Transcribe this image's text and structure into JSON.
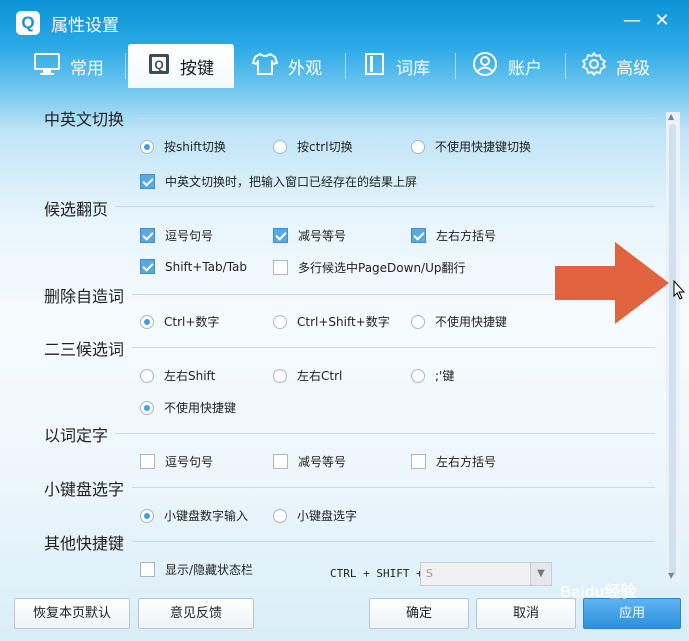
{
  "window": {
    "title": "属性设置",
    "logo": "Q"
  },
  "tabs": [
    {
      "label": "常用",
      "icon": "monitor-icon"
    },
    {
      "label": "按键",
      "icon": "keyboard-q-icon",
      "active": true
    },
    {
      "label": "外观",
      "icon": "tshirt-icon"
    },
    {
      "label": "词库",
      "icon": "book-icon"
    },
    {
      "label": "账户",
      "icon": "user-icon"
    },
    {
      "label": "高级",
      "icon": "gear-icon"
    }
  ],
  "sections": {
    "switch": {
      "title": "中英文切换",
      "radios": [
        "按shift切换",
        "按ctrl切换",
        "不使用快捷键切换"
      ],
      "selected": 0,
      "checkbox": {
        "label": "中英文切换时，把输入窗口已经存在的结果上屏",
        "checked": true
      }
    },
    "paging": {
      "title": "候选翻页",
      "checks": [
        {
          "label": "逗号句号",
          "checked": true
        },
        {
          "label": "减号等号",
          "checked": true
        },
        {
          "label": "左右方括号",
          "checked": true
        },
        {
          "label": "Shift+Tab/Tab",
          "checked": true
        },
        {
          "label": "多行候选中PageDown/Up翻行",
          "checked": false
        }
      ]
    },
    "delete_word": {
      "title": "删除自造词",
      "radios": [
        "Ctrl+数字",
        "Ctrl+Shift+数字",
        "不使用快捷键"
      ],
      "selected": 0
    },
    "second_third": {
      "title": "二三候选词",
      "radios": [
        "左右Shift",
        "左右Ctrl",
        ";'键",
        "不使用快捷键"
      ],
      "selected": 3
    },
    "word_char": {
      "title": "以词定字",
      "checks": [
        {
          "label": "逗号句号",
          "checked": false
        },
        {
          "label": "减号等号",
          "checked": false
        },
        {
          "label": "左右方括号",
          "checked": false
        }
      ]
    },
    "keypad": {
      "title": "小键盘选字",
      "radios": [
        "小键盘数字输入",
        "小键盘选字"
      ],
      "selected": 0
    },
    "other": {
      "title": "其他快捷键",
      "checkbox": {
        "label": "显示/隐藏状态栏",
        "checked": false
      },
      "shortcut_prefix": "CTRL + SHIFT +",
      "shortcut_key": "S"
    }
  },
  "buttons": {
    "restore": "恢复本页默认",
    "feedback": "意见反馈",
    "ok": "确定",
    "cancel": "取消",
    "apply": "应用"
  },
  "watermark": "Baidu经验",
  "colors": {
    "title_bar": "#1b95d8",
    "accent": "#3fa0e6",
    "arrow": "#e0623e"
  }
}
